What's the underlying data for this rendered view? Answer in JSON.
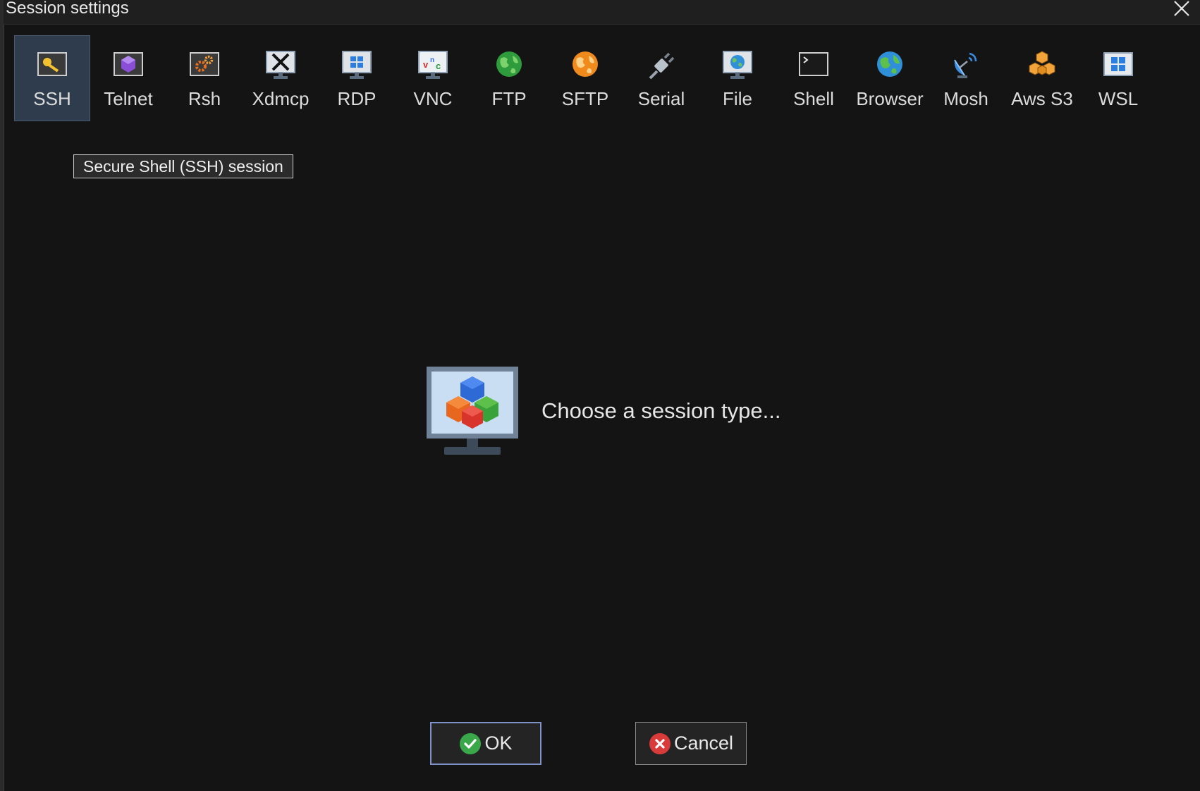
{
  "window": {
    "title": "Session settings",
    "close_icon": "close-icon"
  },
  "toolbar": {
    "selected": "SSH",
    "items": [
      {
        "label": "SSH",
        "icon": "key-icon"
      },
      {
        "label": "Telnet",
        "icon": "telnet-gem-icon"
      },
      {
        "label": "Rsh",
        "icon": "gears-icon"
      },
      {
        "label": "Xdmcp",
        "icon": "x-monitor-icon"
      },
      {
        "label": "RDP",
        "icon": "windows-monitor-icon"
      },
      {
        "label": "VNC",
        "icon": "vnc-monitor-icon"
      },
      {
        "label": "FTP",
        "icon": "green-globe-icon"
      },
      {
        "label": "SFTP",
        "icon": "orange-globe-icon"
      },
      {
        "label": "Serial",
        "icon": "plug-icon"
      },
      {
        "label": "File",
        "icon": "file-monitor-icon"
      },
      {
        "label": "Shell",
        "icon": "terminal-icon"
      },
      {
        "label": "Browser",
        "icon": "earth-icon"
      },
      {
        "label": "Mosh",
        "icon": "satellite-dish-icon"
      },
      {
        "label": "Aws S3",
        "icon": "aws-cubes-icon"
      },
      {
        "label": "WSL",
        "icon": "windows-logo-icon"
      }
    ]
  },
  "tooltip": {
    "text": "Secure Shell (SSH) session"
  },
  "center": {
    "icon": "monitor-cubes-icon",
    "text": "Choose a session type..."
  },
  "buttons": {
    "ok_label": "OK",
    "ok_icon": "check-circle-icon",
    "cancel_label": "Cancel",
    "cancel_icon": "x-circle-icon"
  },
  "colors": {
    "background": "#141414",
    "selected_tool": "#2f3c4d",
    "ok_border": "#7f93c9"
  }
}
